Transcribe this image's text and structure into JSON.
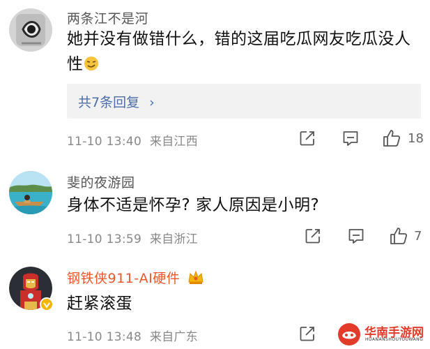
{
  "comments": [
    {
      "user": "两条江不是河",
      "text": "她并没有做错什么，错的这届吃瓜网友吃瓜没人性",
      "text_line1": "她并没有做错什么，错的这届吃瓜网友吃瓜没人",
      "text_line2": "性",
      "emoji": "smirk-emoji",
      "replies_label": "共7条回复",
      "time": "11-10 13:40",
      "location": "来自江西",
      "likes": "18"
    },
    {
      "user": "斐的夜游园",
      "text": "身体不适是怀孕? 家人原因是小明?",
      "time": "11-10 13:59",
      "location": "来自浙江",
      "likes": "7"
    },
    {
      "user": "钢铁侠911-AI硬件",
      "text": "赶紧滚蛋",
      "time": "11-10 13:48",
      "location": "来自广东",
      "likes": ""
    }
  ],
  "icons": {
    "share": "share-icon",
    "comment": "comment-icon",
    "like": "like-icon",
    "crown": "crown-badge-icon",
    "verified": "verified-badge-icon"
  },
  "colors": {
    "vip_name": "#e8572a",
    "reply_link": "#4d6da6",
    "meta_gray": "#888888"
  },
  "watermark": {
    "text": "华南手游网",
    "sub": "HUANANSHOUYOUWANG"
  }
}
